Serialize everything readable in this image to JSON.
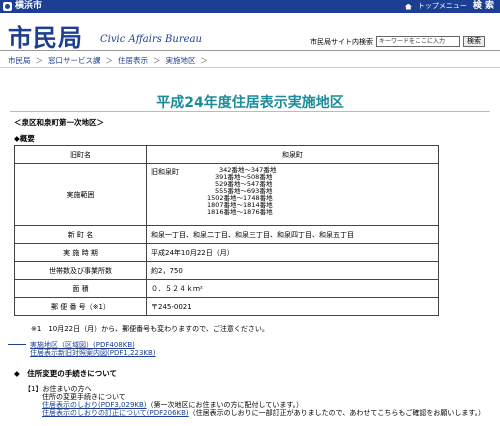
{
  "topbar": {
    "city": "横浜市",
    "menu": "トップメニュー",
    "search": "検 索"
  },
  "header": {
    "title": "市民局",
    "subtitle": "Civic Affairs Bureau",
    "search_label": "市民局サイト内検索",
    "search_placeholder": "キーワードをここに入力",
    "search_button": "検索"
  },
  "breadcrumb": [
    "市民局",
    "窓口サービス課",
    "住居表示",
    "実施地区"
  ],
  "page_title": "平成24年度住居表示実施地区",
  "area_heading": "＜泉区和泉町第一次地区＞",
  "overview_heading": "◆概要",
  "table": {
    "header": {
      "k": "旧町名",
      "v": "和泉町"
    },
    "range_label": "実施範囲",
    "range_town": "旧和泉町",
    "range_list": [
      "342番地～347番地",
      "391番地～508番地",
      "529番地～547番地",
      "555番地～693番地",
      "1502番地～1748番地",
      "1807番地～1814番地",
      "1816番地～1876番地"
    ],
    "rows": [
      {
        "k": "新 町 名",
        "v": "和泉一丁目、和泉二丁目、和泉三丁目、和泉四丁目、和泉五丁目"
      },
      {
        "k": "実 施 時 期",
        "v": "平成24年10月22日（月）"
      },
      {
        "k": "世帯数及び事業所数",
        "v": "約2，750"
      },
      {
        "k": "面 積",
        "v": "０．５２４ｋｍ²"
      },
      {
        "k": "郵 便 番 号（※1）",
        "v": "〒245-0021"
      }
    ]
  },
  "note": "※1　10月22日（月）から、郵便番号も変わりますので、ご注意ください。",
  "links": [
    "実施地区（区域図）(PDF408KB)",
    "住居表示新旧対照案内図(PDF1,223KB)"
  ],
  "section": "◆　住所変更の手続きについて",
  "body": {
    "heading": "【1】お住まいの方へ",
    "line1": "住所の変更手続きについて",
    "link1": "住居表示のしおり(PDF3,029KB)",
    "text1": "（第一次地区にお住まいの方に配付しています。）",
    "link2": "住居表示のしおりの訂正について(PDF206KB)",
    "text2": "（住居表示のしおりに一部訂正がありましたので、あわせてこちらもご確認をお願いします。）"
  }
}
